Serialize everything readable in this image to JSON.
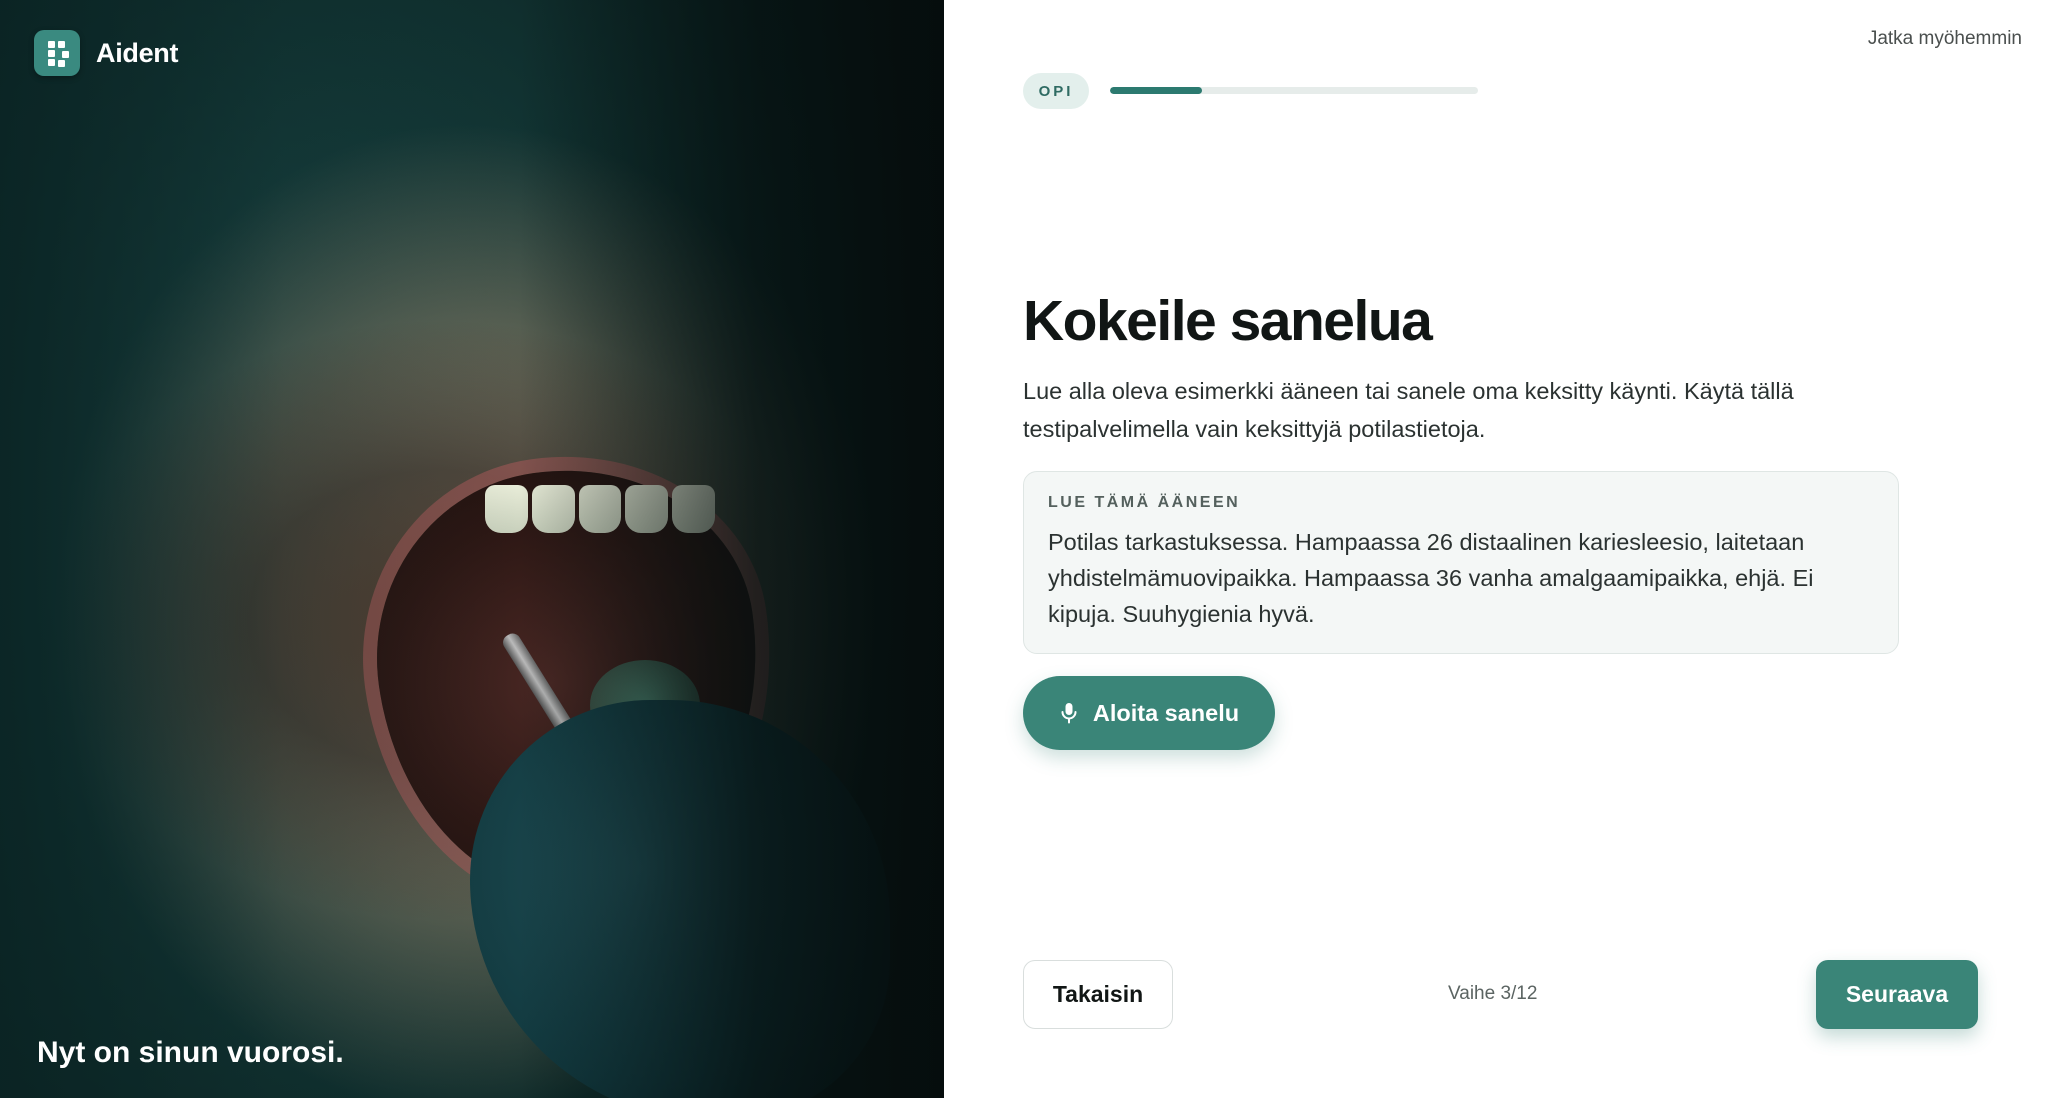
{
  "brand": {
    "name": "Aident"
  },
  "left_panel": {
    "caption": "Nyt on sinun vuorosi."
  },
  "header": {
    "later_link": "Jatka myöhemmin",
    "stage_label": "OPI",
    "progress": 0.25
  },
  "main": {
    "title": "Kokeile sanelua",
    "intro": "Lue alla oleva esimerkki ääneen tai sanele oma keksitty käynti. Käytä tällä testipalvelimella vain keksittyjä potilastietoja.",
    "read_box": {
      "label": "LUE TÄMÄ ÄÄNEEN",
      "text": "Potilas tarkastuksessa. Hampaassa 26 distaalinen kariesleesio, laitetaan yhdistelmämuovipaikka. Hampaassa 36 vanha amalgaamipaikka, ehjä. Ei kipuja. Suuhygienia hyvä."
    },
    "dictate_button": {
      "label": "Aloita sanelu",
      "icon": "microphone-icon"
    }
  },
  "footer": {
    "back_label": "Takaisin",
    "step_text": "Vaihe 3/12",
    "next_label": "Seuraava"
  },
  "colors": {
    "accent": "#3a8578",
    "progress": "#2c7a70",
    "pill_bg": "#e3efec"
  }
}
